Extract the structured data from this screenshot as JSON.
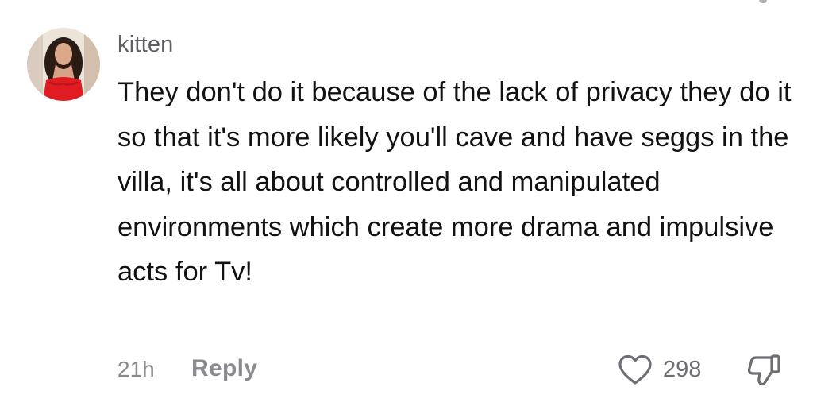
{
  "comment": {
    "username": "kitten",
    "text": "They don't do it because of the lack of privacy they do it so that it's more likely you'll cave and have seggs in the villa, it's all about controlled and manipulated environments which create more drama and impulsive acts for Tv!",
    "timestamp": "21h",
    "reply_label": "Reply",
    "like_count": "298",
    "icons": {
      "like": "heart-outline-icon",
      "dislike": "thumbs-down-outline-icon"
    }
  },
  "colors": {
    "text": "#121212",
    "muted": "#8a8a90",
    "username": "#5f5f66"
  }
}
